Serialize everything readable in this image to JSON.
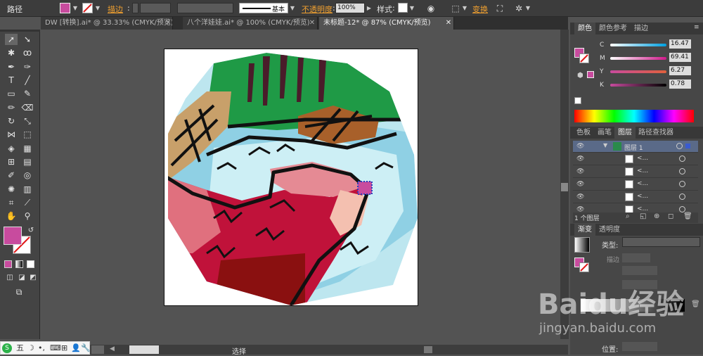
{
  "control_bar": {
    "object_type": "路径",
    "stroke_label": "描边",
    "opacity_label": "不透明度",
    "opacity_value": "100%",
    "style_label": "样式",
    "stroke_profile": "基本",
    "transform_label": "变换"
  },
  "tabs": [
    {
      "label": "DW [转换].ai* @ 33.33% (CMYK/预览)"
    },
    {
      "label": "八个洋娃娃.ai* @ 100% (CMYK/预览)"
    },
    {
      "label": "未标题-12* @ 87% (CMYK/预览)"
    }
  ],
  "color_panel": {
    "tabs": [
      "颜色",
      "颜色参考",
      "描边"
    ],
    "channels": [
      {
        "name": "C",
        "value": "16.47"
      },
      {
        "name": "M",
        "value": "69.41"
      },
      {
        "name": "Y",
        "value": "6.27"
      },
      {
        "name": "K",
        "value": "0.78"
      }
    ],
    "fill_color": "#c84b9e",
    "accent_color": "#c84b9e"
  },
  "layers_panel": {
    "tabs": [
      "色板",
      "画笔",
      "图层",
      "路径查找器"
    ],
    "layer_name": "图层 1",
    "sublayer_label": "<...",
    "footer": "1 个图层"
  },
  "gradient_panel": {
    "tabs": [
      "渐变",
      "透明度"
    ],
    "type_label": "类型:",
    "stroke_label": "描边",
    "position_label": "位置:"
  },
  "status_bar": {
    "mode": "选择"
  },
  "ime_bar": {
    "label": "五"
  },
  "watermark": {
    "brand": "Baidu经验",
    "url": "jingyan.baidu.com"
  }
}
